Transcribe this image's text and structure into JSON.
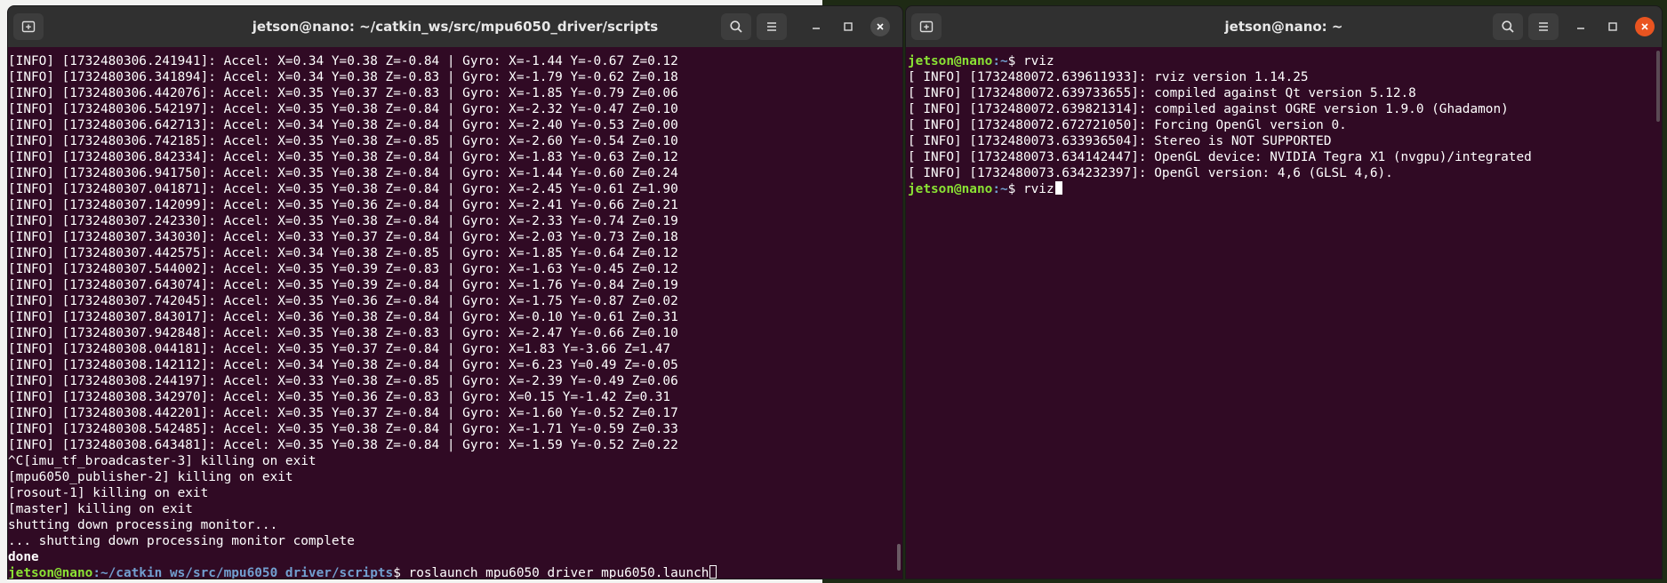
{
  "colors": {
    "terminal_bg": "#300a24",
    "titlebar_bg": "#303030",
    "prompt_user": "#8ae234",
    "prompt_path": "#729fcf",
    "close_accent": "#e95420"
  },
  "left_window": {
    "title": "jetson@nano: ~/catkin_ws/src/mpu6050_driver/scripts",
    "icons": {
      "new_tab": "new-tab-icon",
      "search": "search-icon",
      "menu": "hamburger-menu-icon",
      "minimize": "minimize-icon",
      "maximize": "maximize-icon",
      "close": "close-icon"
    },
    "lines": [
      "[INFO] [1732480306.241941]: Accel: X=0.34 Y=0.38 Z=-0.84 | Gyro: X=-1.44 Y=-0.67 Z=0.12",
      "[INFO] [1732480306.341894]: Accel: X=0.34 Y=0.38 Z=-0.83 | Gyro: X=-1.79 Y=-0.62 Z=0.18",
      "[INFO] [1732480306.442076]: Accel: X=0.35 Y=0.37 Z=-0.83 | Gyro: X=-1.85 Y=-0.79 Z=0.06",
      "[INFO] [1732480306.542197]: Accel: X=0.35 Y=0.38 Z=-0.84 | Gyro: X=-2.32 Y=-0.47 Z=0.10",
      "[INFO] [1732480306.642713]: Accel: X=0.34 Y=0.38 Z=-0.84 | Gyro: X=-2.40 Y=-0.53 Z=0.00",
      "[INFO] [1732480306.742185]: Accel: X=0.35 Y=0.38 Z=-0.85 | Gyro: X=-2.60 Y=-0.54 Z=0.10",
      "[INFO] [1732480306.842334]: Accel: X=0.35 Y=0.38 Z=-0.84 | Gyro: X=-1.83 Y=-0.63 Z=0.12",
      "[INFO] [1732480306.941750]: Accel: X=0.35 Y=0.38 Z=-0.84 | Gyro: X=-1.44 Y=-0.60 Z=0.24",
      "[INFO] [1732480307.041871]: Accel: X=0.35 Y=0.38 Z=-0.84 | Gyro: X=-2.45 Y=-0.61 Z=1.90",
      "[INFO] [1732480307.142099]: Accel: X=0.35 Y=0.36 Z=-0.84 | Gyro: X=-2.41 Y=-0.66 Z=0.21",
      "[INFO] [1732480307.242330]: Accel: X=0.35 Y=0.38 Z=-0.84 | Gyro: X=-2.33 Y=-0.74 Z=0.19",
      "[INFO] [1732480307.343030]: Accel: X=0.33 Y=0.37 Z=-0.84 | Gyro: X=-2.03 Y=-0.73 Z=0.18",
      "[INFO] [1732480307.442575]: Accel: X=0.34 Y=0.38 Z=-0.85 | Gyro: X=-1.85 Y=-0.64 Z=0.12",
      "[INFO] [1732480307.544002]: Accel: X=0.35 Y=0.39 Z=-0.83 | Gyro: X=-1.63 Y=-0.45 Z=0.12",
      "[INFO] [1732480307.643074]: Accel: X=0.35 Y=0.39 Z=-0.84 | Gyro: X=-1.76 Y=-0.84 Z=0.19",
      "[INFO] [1732480307.742045]: Accel: X=0.35 Y=0.36 Z=-0.84 | Gyro: X=-1.75 Y=-0.87 Z=0.02",
      "[INFO] [1732480307.843017]: Accel: X=0.36 Y=0.38 Z=-0.84 | Gyro: X=-0.10 Y=-0.61 Z=0.31",
      "[INFO] [1732480307.942848]: Accel: X=0.35 Y=0.38 Z=-0.83 | Gyro: X=-2.47 Y=-0.66 Z=0.10",
      "[INFO] [1732480308.044181]: Accel: X=0.35 Y=0.37 Z=-0.84 | Gyro: X=1.83 Y=-3.66 Z=1.47",
      "[INFO] [1732480308.142112]: Accel: X=0.34 Y=0.38 Z=-0.84 | Gyro: X=-6.23 Y=0.49 Z=-0.05",
      "[INFO] [1732480308.244197]: Accel: X=0.33 Y=0.38 Z=-0.85 | Gyro: X=-2.39 Y=-0.49 Z=0.06",
      "[INFO] [1732480308.342970]: Accel: X=0.35 Y=0.36 Z=-0.83 | Gyro: X=0.15 Y=-1.42 Z=0.31",
      "[INFO] [1732480308.442201]: Accel: X=0.35 Y=0.37 Z=-0.84 | Gyro: X=-1.60 Y=-0.52 Z=0.17",
      "[INFO] [1732480308.542485]: Accel: X=0.35 Y=0.38 Z=-0.84 | Gyro: X=-1.71 Y=-0.59 Z=0.33",
      "[INFO] [1732480308.643481]: Accel: X=0.35 Y=0.38 Z=-0.84 | Gyro: X=-1.59 Y=-0.52 Z=0.22",
      "^C[imu_tf_broadcaster-3] killing on exit",
      "[mpu6050_publisher-2] killing on exit",
      "[rosout-1] killing on exit",
      "[master] killing on exit",
      "shutting down processing monitor...",
      "... shutting down processing monitor complete"
    ],
    "done_text": "done",
    "prompt_user": "jetson@nano",
    "prompt_path": ":~/catkin_ws/src/mpu6050_driver/scripts",
    "prompt_symbol": "$ ",
    "command": "roslaunch mpu6050_driver mpu6050.launch"
  },
  "right_window": {
    "title": "jetson@nano: ~",
    "icons": {
      "new_tab": "new-tab-icon",
      "search": "search-icon",
      "menu": "hamburger-menu-icon",
      "minimize": "minimize-icon",
      "maximize": "maximize-icon",
      "close": "close-icon"
    },
    "prompt_user": "jetson@nano",
    "prompt_path": ":~",
    "prompt_symbol": "$ ",
    "first_command": "rviz",
    "lines": [
      "[ INFO] [1732480072.639611933]: rviz version 1.14.25",
      "[ INFO] [1732480072.639733655]: compiled against Qt version 5.12.8",
      "[ INFO] [1732480072.639821314]: compiled against OGRE version 1.9.0 (Ghadamon)",
      "[ INFO] [1732480072.672721050]: Forcing OpenGl version 0.",
      "[ INFO] [1732480073.633936504]: Stereo is NOT SUPPORTED",
      "[ INFO] [1732480073.634142447]: OpenGL device: NVIDIA Tegra X1 (nvgpu)/integrated",
      "[ INFO] [1732480073.634232397]: OpenGl version: 4,6 (GLSL 4,6)."
    ],
    "second_command": "rviz"
  }
}
